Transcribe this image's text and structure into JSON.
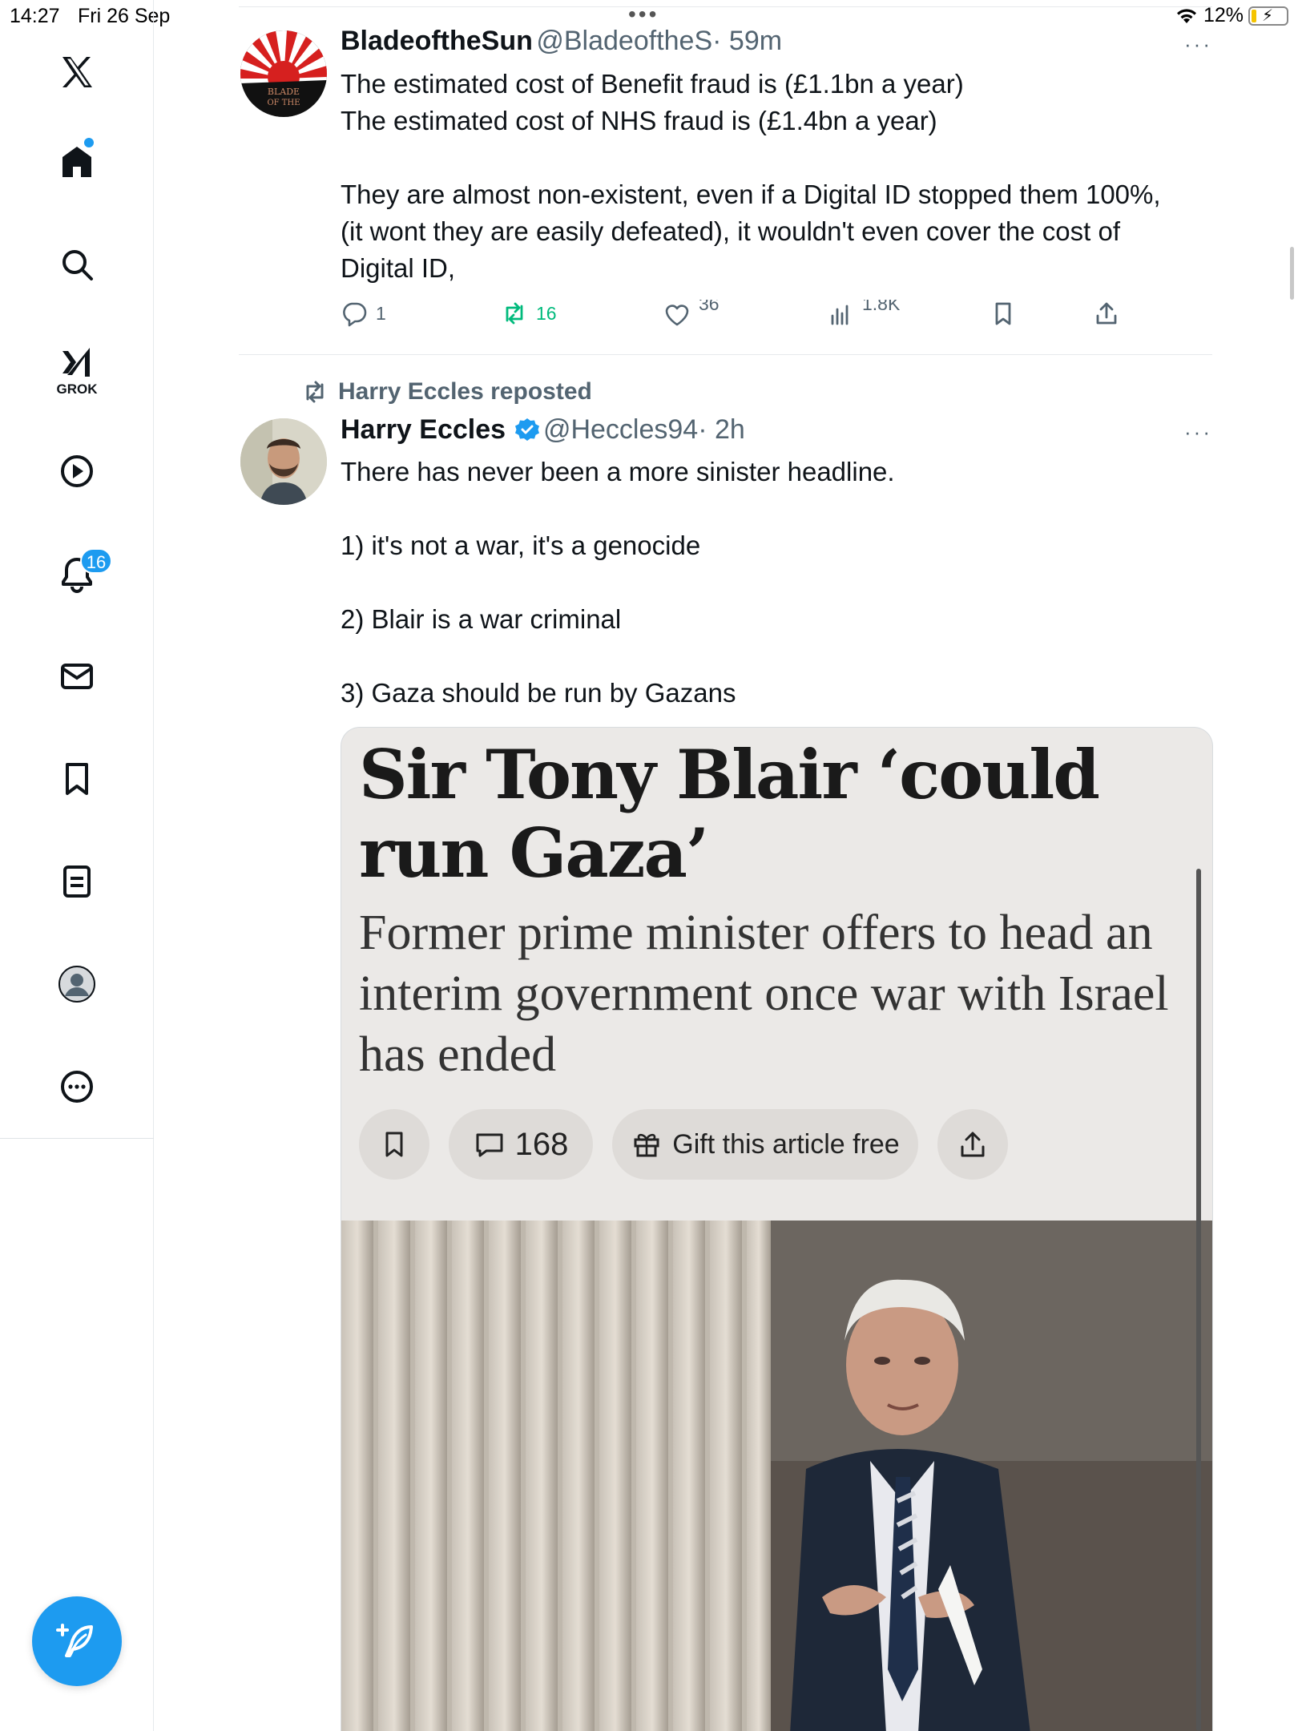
{
  "status_bar": {
    "time": "14:27",
    "date": "Fri 26 Sep",
    "battery": "12%"
  },
  "sidebar": {
    "grok_label": "GROK",
    "notifications_count": "16",
    "icons": [
      "x-logo-icon",
      "home-icon",
      "search-icon",
      "grok-icon",
      "video-icon",
      "notifications-icon",
      "messages-icon",
      "bookmarks-icon",
      "lists-icon",
      "profile-icon",
      "more-icon"
    ]
  },
  "post1": {
    "name": "BladeoftheSun",
    "handle": "@BladeoftheS",
    "time": "· 59m",
    "text": "The estimated cost of Benefit fraud is (£1.1bn a year)\nThe estimated cost of NHS fraud is (£1.4bn a year)\n\nThey are almost non-existent, even if a Digital ID stopped them 100%,\n(it wont they are easily defeated), it wouldn't even cover the cost of\nDigital ID,",
    "avatar_text": "BLADE OF THE",
    "replies": "1",
    "reposts": "16",
    "likes": "36",
    "views": "1.8K",
    "more": "···"
  },
  "post2": {
    "repost_label": "Harry Eccles reposted",
    "name": "Harry Eccles",
    "handle": "@Heccles94",
    "time": "· 2h",
    "text": "There has never been a more sinister headline.\n\n1) it's not a war, it's a genocide\n\n2) Blair is a war criminal\n\n3) Gaza should be run by Gazans",
    "more": "···",
    "card": {
      "headline": "Sir Tony Blair ‘could run Gaza’",
      "subheadline": "Former prime minister offers to head an interim government once war with Israel has ended",
      "comments": "168",
      "gift_label": "Gift this article free"
    }
  },
  "colors": {
    "accent": "#1d9bf0",
    "repost_green": "#00ba7c",
    "muted": "#536471",
    "card_bg": "#ebe9e7"
  }
}
